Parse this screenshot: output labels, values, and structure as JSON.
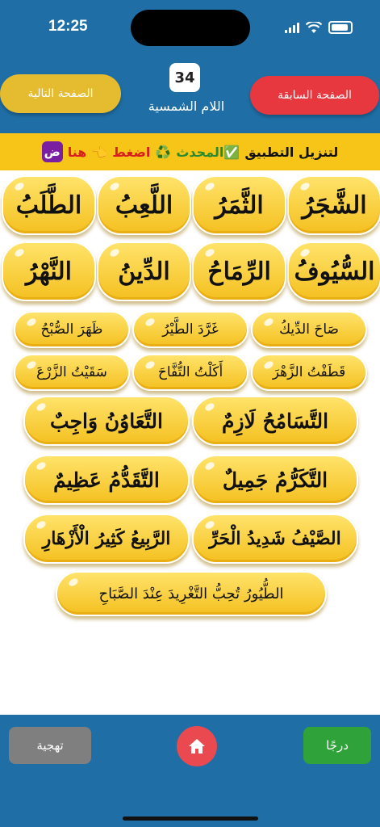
{
  "status": {
    "time": "12:25"
  },
  "header": {
    "page_number": "34",
    "title": "اللام الشمسية",
    "next_label": "الصفحة التالية",
    "prev_label": "الصفحة السابقة"
  },
  "banner": {
    "part1": "لتنزيل التطبيق",
    "part2": "✅المحدث",
    "part3": "♻️",
    "part4": "اضغط",
    "part5": "👈",
    "part6": "هنا",
    "app_letter": "ض"
  },
  "words": [
    "الشَّجَرُ",
    "الثَّمَرُ",
    "اللَّعِبُ",
    "الطَّلَبُ",
    "السُّيُوفُ",
    "الرِّمَاحُ",
    "الدِّينُ",
    "النَّهْرُ"
  ],
  "phrases": [
    "صَاحَ الدِّيكُ",
    "غَرَّدَ الطَّيْرُ",
    "ظَهَرَ الصُّبْحُ",
    "قَطَفْتُ الزَّهْرَ",
    "أَكَلْتُ التُّفَّاحَ",
    "سَقَيْتُ الزَّرْعَ"
  ],
  "sentences": [
    "التَّسَامُحُ لَازِمٌ",
    "التَّعَاوُنُ وَاجِبٌ",
    "التَّكَرُّمُ جَمِيلٌ",
    "التَّقَدُّمُ عَظِيمٌ",
    "الصَّيْفُ شَدِيدُ الْحَرِّ",
    "الرَّبِيعُ كَثِيرُ الْأَزْهَارِ",
    "الطُّيُورُ تُحِبُّ التَّغْرِيدَ عِنْدَ الصَّبَاحِ"
  ],
  "footer": {
    "spell_label": "تهجية",
    "drag_label": "درجًا"
  },
  "colors": {
    "primary": "#1f6fa6",
    "banner": "#f6c518",
    "pill": "#f4c020",
    "next": "#e5bb2f",
    "prev": "#e8383f",
    "home": "#ea4a4f",
    "drag": "#2fa23a",
    "spell": "#7f7f7f"
  }
}
